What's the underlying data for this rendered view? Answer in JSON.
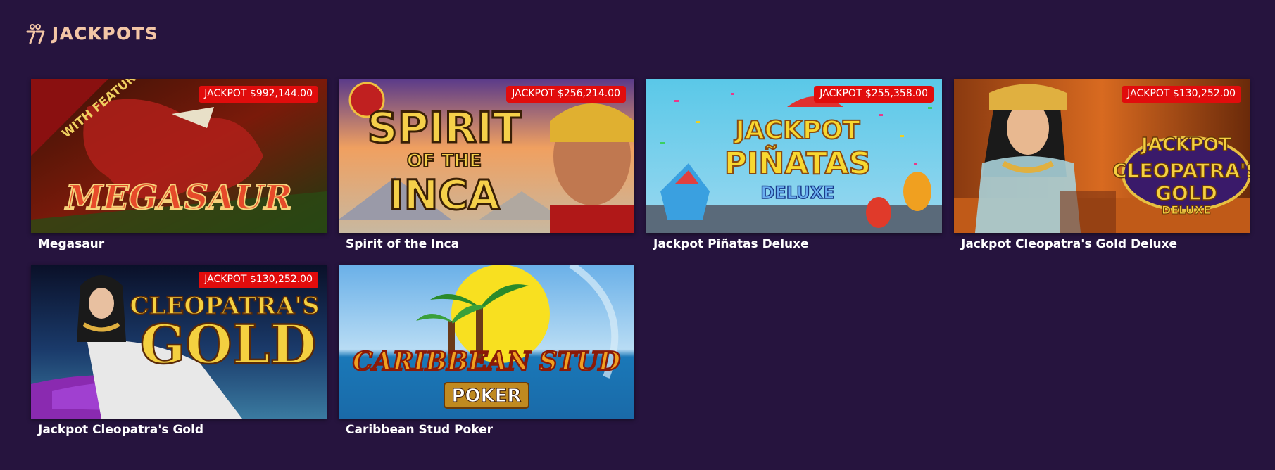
{
  "header": {
    "title": "JACKPOTS",
    "icon": "sevens-icon",
    "accent_color": "#f3c6a6"
  },
  "colors": {
    "background": "#26143e",
    "badge": "#e10c0c"
  },
  "games": [
    {
      "title": "Megasaur",
      "jackpot": "JACKPOT $992,144.00",
      "art_text": "MEGASAUR",
      "art_ribbon": "WITH FEATURE GUARANTEE"
    },
    {
      "title": "Spirit of the Inca",
      "jackpot": "JACKPOT $256,214.00",
      "art_text": "SPIRIT",
      "art_text2": "OF THE",
      "art_text3": "INCA"
    },
    {
      "title": "Jackpot Piñatas Deluxe",
      "jackpot": "JACKPOT $255,358.00",
      "art_text": "JACKPOT",
      "art_text2": "PIÑATAS",
      "art_text3": "DELUXE"
    },
    {
      "title": "Jackpot Cleopatra's Gold Deluxe",
      "jackpot": "JACKPOT $130,252.00",
      "art_text": "JACKPOT",
      "art_text2": "CLEOPATRA'S",
      "art_text3": "GOLD",
      "art_text4": "DELUXE"
    },
    {
      "title": "Jackpot Cleopatra's Gold",
      "jackpot": "JACKPOT $130,252.00",
      "art_text": "CLEOPATRA'S",
      "art_text2": "GOLD"
    },
    {
      "title": "Caribbean Stud Poker",
      "jackpot": "",
      "art_text": "CARIBBEAN STUD",
      "art_text2": "POKER"
    }
  ]
}
